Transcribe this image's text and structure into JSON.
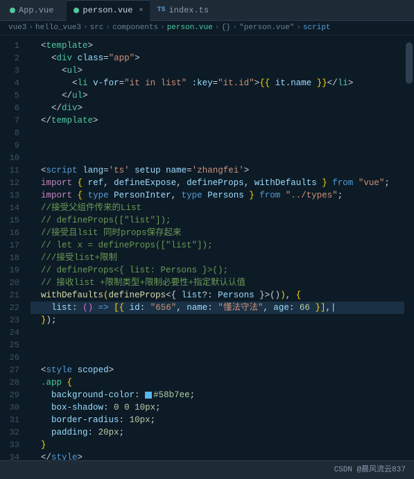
{
  "tabs": [
    {
      "id": "app-vue",
      "label": "App.vue",
      "icon": "vue-green",
      "active": false,
      "closable": false
    },
    {
      "id": "person-vue",
      "label": "person.vue",
      "icon": "vue-green",
      "active": true,
      "closable": true
    },
    {
      "id": "index-ts",
      "label": "index.ts",
      "icon": "ts-blue",
      "active": false,
      "closable": false
    }
  ],
  "breadcrumb": {
    "parts": [
      "vue3",
      ">",
      "hello_vue3",
      ">",
      "src",
      ">",
      "components",
      ">",
      "person.vue",
      ">",
      "{}",
      "\"person.vue\"",
      ">",
      "script"
    ]
  },
  "lines": [
    {
      "num": 1,
      "content": "  <template>"
    },
    {
      "num": 2,
      "content": "    <div class=\"app\">"
    },
    {
      "num": 3,
      "content": "      <ul>"
    },
    {
      "num": 4,
      "content": "        <li v-for=\"it in list\" :key=\"it.id\">{{ it.name }}</li>"
    },
    {
      "num": 5,
      "content": "      </ul>"
    },
    {
      "num": 6,
      "content": "    </div>"
    },
    {
      "num": 7,
      "content": "  </template>"
    },
    {
      "num": 8,
      "content": ""
    },
    {
      "num": 9,
      "content": ""
    },
    {
      "num": 10,
      "content": ""
    },
    {
      "num": 11,
      "content": "  <script lang='ts' setup name='zhangfei'>"
    },
    {
      "num": 12,
      "content": "  import { ref, defineExpose, defineProps, withDefaults } from \"vue\";"
    },
    {
      "num": 13,
      "content": "  import { type PersonInter, type Persons } from \"../types\";"
    },
    {
      "num": 14,
      "content": "  //接受父组件传来的List"
    },
    {
      "num": 15,
      "content": "  // defineProps([\"list\"]);"
    },
    {
      "num": 16,
      "content": "  //接受且lsit 同时props保存起来"
    },
    {
      "num": 17,
      "content": "  // let x = defineProps([\"list\"]);"
    },
    {
      "num": 18,
      "content": "  ///接受list+限制"
    },
    {
      "num": 19,
      "content": "  // defineProps<{ list: Persons }>();"
    },
    {
      "num": 20,
      "content": "  // 接收list +限制类型+限制必要性+指定默认认值"
    },
    {
      "num": 21,
      "content": "  withDefaults(defineProps<{ list?: Persons }>(), {"
    },
    {
      "num": 22,
      "content": "    list: () => [{ id: \"656\", name: \"懂法守法\", age: 66 }],"
    },
    {
      "num": 23,
      "content": "  });"
    },
    {
      "num": 24,
      "content": ""
    },
    {
      "num": 25,
      "content": ""
    },
    {
      "num": 26,
      "content": ""
    },
    {
      "num": 27,
      "content": "  <style scoped>"
    },
    {
      "num": 28,
      "content": "  .app {"
    },
    {
      "num": 29,
      "content": "    background-color: #58b7ee;"
    },
    {
      "num": 30,
      "content": "    box-shadow: 0 0 10px;"
    },
    {
      "num": 31,
      "content": "    border-radius: 10px;"
    },
    {
      "num": 32,
      "content": "    padding: 20px;"
    },
    {
      "num": 33,
      "content": "  }"
    },
    {
      "num": 34,
      "content": "  </style>"
    }
  ],
  "status_bar": {
    "text": "CSDN @晨风流云837"
  }
}
